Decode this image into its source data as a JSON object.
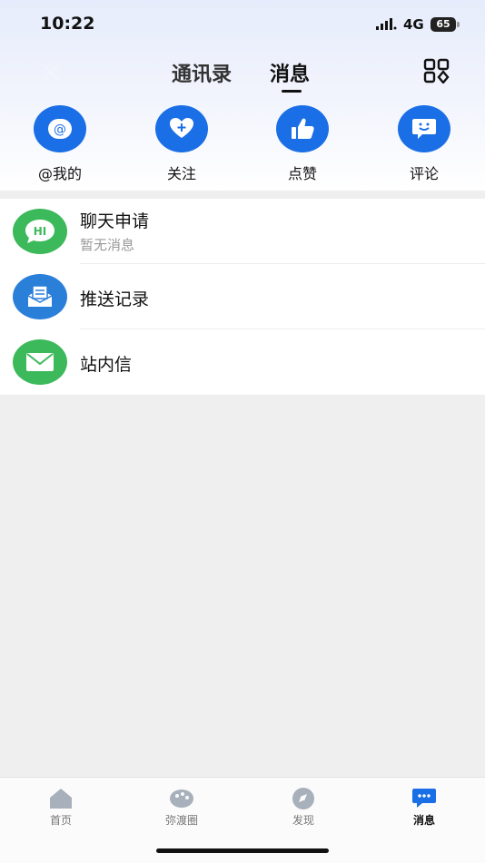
{
  "status": {
    "time": "10:22",
    "network": "4G",
    "battery": "65"
  },
  "header": {
    "tabs": [
      {
        "label": "通讯录"
      },
      {
        "label": "消息"
      }
    ],
    "active_tab": "消息"
  },
  "quick_actions": [
    {
      "label": "@我的",
      "icon": "at-icon"
    },
    {
      "label": "关注",
      "icon": "heart-plus-icon"
    },
    {
      "label": "点赞",
      "icon": "thumbs-up-icon"
    },
    {
      "label": "评论",
      "icon": "comment-icon"
    }
  ],
  "list": [
    {
      "title": "聊天申请",
      "subtitle": "暂无消息",
      "icon": "hi-chat-icon",
      "icon_text": "HI",
      "color": "#3cb95a"
    },
    {
      "title": "推送记录",
      "subtitle": "",
      "icon": "push-inbox-icon",
      "color": "#2a7fd9"
    },
    {
      "title": "站内信",
      "subtitle": "",
      "icon": "mail-icon",
      "color": "#3cb95a"
    }
  ],
  "tabbar": [
    {
      "label": "首页",
      "icon": "home-icon"
    },
    {
      "label": "弥渡圈",
      "icon": "palette-icon"
    },
    {
      "label": "发现",
      "icon": "compass-icon"
    },
    {
      "label": "消息",
      "icon": "chat-bubble-icon",
      "active": true
    }
  ],
  "colors": {
    "accent": "#1a6fe6",
    "green": "#3cb95a",
    "tab_active": "#1a6fe6"
  }
}
